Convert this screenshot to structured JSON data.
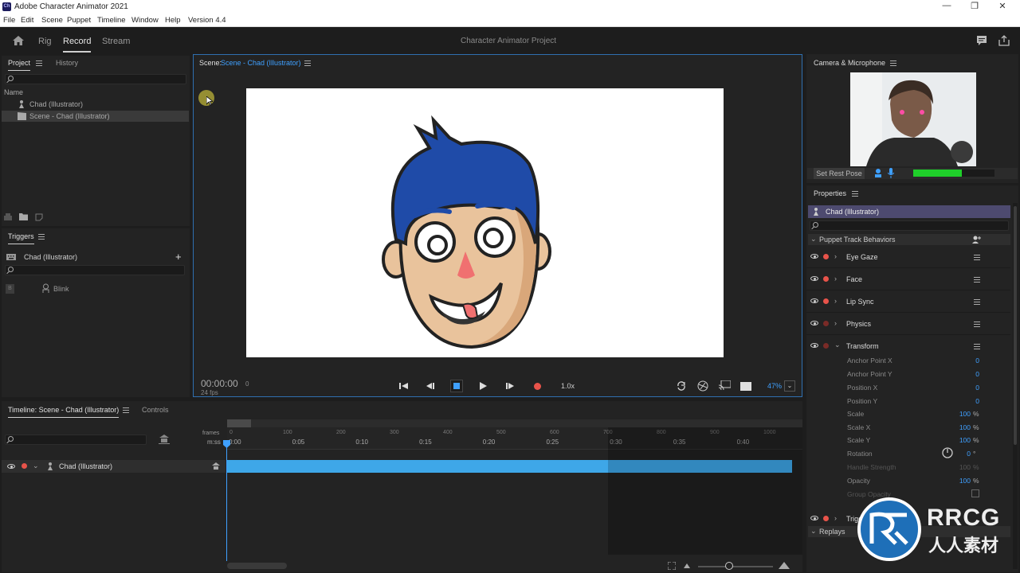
{
  "os": {
    "app_title": "Adobe Character Animator 2021",
    "app_icon": "Ch",
    "min_glyph": "—",
    "max_glyph": "❐",
    "close_glyph": "✕"
  },
  "menu": [
    "File",
    "Edit",
    "Scene",
    "Puppet",
    "Timeline",
    "Window",
    "Help",
    "Version 4.4"
  ],
  "header": {
    "modes": [
      "Rig",
      "Record",
      "Stream"
    ],
    "active_mode": "Record",
    "project_title": "Character Animator Project"
  },
  "project_panel": {
    "tabs": [
      "Project",
      "History"
    ],
    "column_name": "Name",
    "items": [
      "Chad (Illustrator)",
      "Scene - Chad (Illustrator)"
    ]
  },
  "triggers_panel": {
    "title": "Triggers",
    "puppet": "Chad (Illustrator)",
    "add_glyph": "+",
    "trigger_key": "B",
    "trigger_name": "Blink"
  },
  "scene_panel": {
    "label": "Scene:",
    "scene_name": "Scene - Chad (Illustrator)",
    "timecode": "00:00:00",
    "frame": "0",
    "fps": "24 fps",
    "speed": "1.0x",
    "zoom": "47%"
  },
  "camera_panel": {
    "title": "Camera & Microphone",
    "set_rest_pose": "Set Rest Pose",
    "audio_level": 0.6
  },
  "properties": {
    "title": "Properties",
    "selected": "Chad (Illustrator)",
    "section": "Puppet Track Behaviors",
    "behaviors": [
      "Eye Gaze",
      "Face",
      "Lip Sync",
      "Physics",
      "Transform",
      "Triggers"
    ],
    "transform_params": [
      {
        "name": "Anchor Point X",
        "value": "0",
        "unit": ""
      },
      {
        "name": "Anchor Point Y",
        "value": "0",
        "unit": ""
      },
      {
        "name": "Position X",
        "value": "0",
        "unit": ""
      },
      {
        "name": "Position Y",
        "value": "0",
        "unit": ""
      },
      {
        "name": "Scale",
        "value": "100",
        "unit": "%"
      },
      {
        "name": "Scale X",
        "value": "100",
        "unit": "%"
      },
      {
        "name": "Scale Y",
        "value": "100",
        "unit": "%"
      },
      {
        "name": "Rotation",
        "value": "0",
        "unit": "°"
      },
      {
        "name": "Handle Strength",
        "value": "100",
        "unit": "%"
      },
      {
        "name": "Opacity",
        "value": "100",
        "unit": "%"
      },
      {
        "name": "Group Opacity",
        "value": "",
        "unit": ""
      }
    ],
    "replays": "Replays"
  },
  "timeline": {
    "tabs": [
      "Timeline: Scene - Chad (Illustrator)",
      "Controls"
    ],
    "frames_label": "frames",
    "time_label": "m:ss",
    "frame_ticks": [
      "0",
      "100",
      "200",
      "300",
      "400",
      "500",
      "600",
      "700",
      "800",
      "900",
      "1000"
    ],
    "time_ticks": [
      "0:00",
      "0:05",
      "0:10",
      "0:15",
      "0:20",
      "0:25",
      "0:30",
      "0:35",
      "0:40"
    ],
    "track_name": "Chad (Illustrator)"
  },
  "watermark": {
    "brand": "RRCG",
    "sub": "人人素材"
  },
  "colors": {
    "accent": "#3fa0ff",
    "record": "#e8534a",
    "track": "#3ea7e8",
    "selection": "#4d4a6f",
    "audio": "#1fcf2a"
  }
}
